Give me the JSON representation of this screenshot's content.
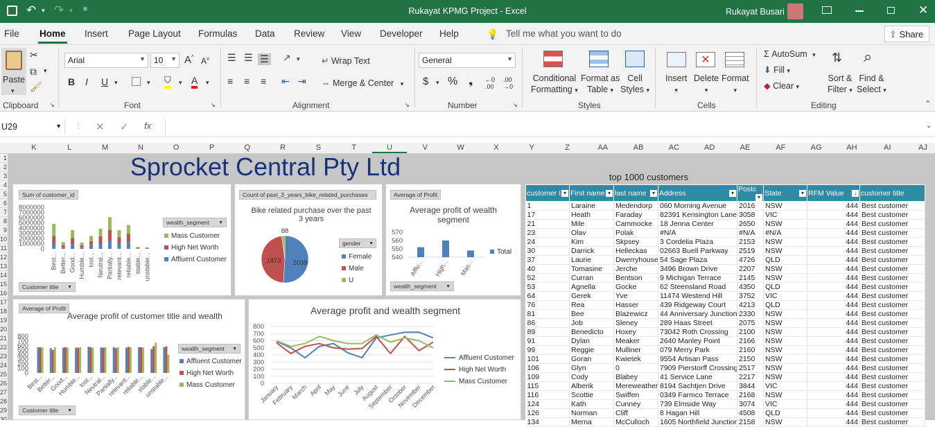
{
  "window": {
    "title": "Rukayat KPMG Project  -  Excel",
    "user": "Rukayat Busari"
  },
  "menu": {
    "tabs": [
      "File",
      "Home",
      "Insert",
      "Page Layout",
      "Formulas",
      "Data",
      "Review",
      "View",
      "Developer",
      "Help"
    ],
    "active": "Home",
    "tell_me": "Tell me what you want to do",
    "share": "Share"
  },
  "ribbon": {
    "paste": "Paste",
    "clipboard": "Clipboard",
    "font_name": "Arial",
    "font_size": "10",
    "font_group": "Font",
    "wrap_text": "Wrap Text",
    "merge_center": "Merge & Center",
    "alignment_group": "Alignment",
    "number_format": "General",
    "number_group": "Number",
    "conditional": "Conditional",
    "formatting": "Formatting",
    "format_as": "Format as",
    "table": "Table",
    "cell": "Cell",
    "styles_word": "Styles",
    "styles_group": "Styles",
    "insert": "Insert",
    "delete": "Delete",
    "format": "Format",
    "cells_group": "Cells",
    "autosum": "AutoSum",
    "fill": "Fill",
    "clear": "Clear",
    "sort_filter_1": "Sort &",
    "sort_filter_2": "Filter",
    "find_select_1": "Find &",
    "find_select_2": "Select",
    "editing_group": "Editing"
  },
  "formula_bar": {
    "name_box": "U29",
    "formula": ""
  },
  "columns": [
    "K",
    "L",
    "M",
    "N",
    "O",
    "P",
    "Q",
    "R",
    "S",
    "T",
    "U",
    "V",
    "W",
    "X",
    "Y",
    "Z",
    "AA",
    "AB",
    "AC",
    "AD",
    "AE",
    "AF",
    "AG",
    "AH",
    "AI",
    "AJ"
  ],
  "rows": [
    "1",
    "2",
    "3",
    "4",
    "5",
    "6",
    "7",
    "8",
    "9",
    "10",
    "11",
    "12",
    "13",
    "14",
    "15",
    "16",
    "17",
    "18",
    "19",
    "20",
    "21",
    "22",
    "23",
    "24",
    "25",
    "26",
    "27",
    "28",
    "29",
    "30"
  ],
  "dashboard": {
    "title": "Sprocket Central Pty Ltd",
    "table_title": "top 1000 customers"
  },
  "chart1": {
    "field_button": "Sum of customer_id",
    "filter_button": "Customer title",
    "legend_button": "wealth_segment",
    "chart_data": {
      "type": "bar",
      "stacked": true,
      "categories": [
        "Best...",
        "Better...",
        "Good...",
        "Humble...",
        "lost...",
        "Neutral...",
        "Partially...",
        "relevant...",
        "reliable...",
        "stable...",
        "unstable..."
      ],
      "series": [
        {
          "name": "Mass Customer",
          "color": "#9bbb59",
          "values": [
            2300000,
            600000,
            1500000,
            500000,
            1000000,
            1500000,
            2500000,
            1400000,
            1700000,
            150000,
            100000
          ]
        },
        {
          "name": "High Net Worth",
          "color": "#c0504d",
          "values": [
            1500000,
            400000,
            1200000,
            400000,
            800000,
            1400000,
            2000000,
            1200000,
            1600000,
            100000,
            100000
          ]
        },
        {
          "name": "Affluent Customer",
          "color": "#4f81bd",
          "values": [
            1000000,
            300000,
            900000,
            300000,
            700000,
            1000000,
            1600000,
            1000000,
            1300000,
            100000,
            80000
          ]
        }
      ],
      "yticks": [
        "8000000",
        "7000000",
        "6000000",
        "5000000",
        "4000000",
        "3000000",
        "2000000",
        "1000000",
        "0"
      ],
      "ylim": [
        0,
        8000000
      ]
    }
  },
  "chart2": {
    "field_button": "Count of past_3_years_bike_related_purchases",
    "legend_button": "gender",
    "chart_data": {
      "type": "pie",
      "title": "Bike related purchase over the past 3 years",
      "slices": [
        {
          "name": "Female",
          "value": 2039,
          "color": "#4f81bd"
        },
        {
          "name": "Male",
          "value": 1873,
          "color": "#c0504d"
        },
        {
          "name": "U",
          "value": 88,
          "color": "#9bbb59"
        }
      ]
    }
  },
  "chart3": {
    "field_button": "Average of Profit",
    "filter_button": "wealth_segment",
    "chart_data": {
      "type": "bar",
      "title": "Average profit of wealth segment",
      "categories": [
        "Afflu...",
        "High...",
        "Mas..."
      ],
      "series": [
        {
          "name": "Total",
          "color": "#4f81bd",
          "values": [
            552,
            560,
            548
          ]
        }
      ],
      "yticks": [
        "570",
        "560",
        "550",
        "540"
      ],
      "ylim": [
        540,
        570
      ]
    }
  },
  "chart4": {
    "field_button": "Average of Profit",
    "filter_button": "Customer title",
    "legend_button": "wealth_segment",
    "chart_data": {
      "type": "bar",
      "title": "Average profit  of customer title and wealth",
      "categories": [
        "Best...",
        "Better...",
        "Good...",
        "Humble...",
        "lost...",
        "Neutral...",
        "Partially...",
        "relevant...",
        "reliable...",
        "stable...",
        "unstable..."
      ],
      "series": [
        {
          "name": "Affluent Customer",
          "color": "#4f81bd",
          "values": [
            560,
            540,
            550,
            550,
            570,
            555,
            560,
            550,
            560,
            520,
            560
          ]
        },
        {
          "name": "High Net Worth",
          "color": "#c0504d",
          "values": [
            560,
            500,
            560,
            550,
            560,
            550,
            540,
            570,
            560,
            580,
            580
          ]
        },
        {
          "name": "Mass Customer",
          "color": "#9bbb59",
          "values": [
            550,
            560,
            550,
            560,
            550,
            560,
            560,
            560,
            550,
            660,
            400
          ]
        }
      ],
      "yticks": [
        "800",
        "700",
        "600",
        "500",
        "400",
        "300",
        "200",
        "100",
        "0"
      ],
      "ylim": [
        0,
        800
      ]
    }
  },
  "chart5": {
    "chart_data": {
      "type": "line",
      "title": "Average profit and wealth segment",
      "categories": [
        "January",
        "February",
        "March",
        "April",
        "May",
        "June",
        "July",
        "August",
        "September",
        "October",
        "November",
        "December"
      ],
      "series": [
        {
          "name": "Affluent Customer",
          "color": "#4f81bd",
          "values": [
            590,
            500,
            360,
            520,
            560,
            430,
            360,
            640,
            680,
            720,
            720,
            640
          ]
        },
        {
          "name": "High Net Worth",
          "color": "#c0504d",
          "values": [
            570,
            420,
            520,
            560,
            500,
            480,
            490,
            660,
            420,
            660,
            460,
            580
          ]
        },
        {
          "name": "Mass Customer",
          "color": "#9bbb59",
          "values": [
            600,
            520,
            560,
            660,
            600,
            560,
            560,
            680,
            580,
            640,
            600,
            500
          ]
        }
      ],
      "yticks": [
        "800",
        "700",
        "600",
        "500",
        "400",
        "300",
        "200",
        "100",
        "0"
      ],
      "ylim": [
        0,
        800
      ]
    }
  },
  "table": {
    "headers": [
      "customer I",
      "First name",
      "last name",
      "Address",
      "Postc",
      "State",
      "RFM Value",
      "customer title"
    ],
    "rows": [
      [
        "1",
        "Laraine",
        "Medendorp",
        "060 Morning Avenue",
        "2016",
        "NSW",
        "444",
        "Best customer"
      ],
      [
        "17",
        "Heath",
        "Faraday",
        "82391 Kensington Lane",
        "3058",
        "VIC",
        "444",
        "Best customer"
      ],
      [
        "21",
        "Mile",
        "Cammocke",
        "18 Jenna Center",
        "2650",
        "NSW",
        "444",
        "Best customer"
      ],
      [
        "23",
        "Olav",
        "Polak",
        "#N/A",
        "#N/A",
        "#N/A",
        "444",
        "Best customer"
      ],
      [
        "24",
        "Kim",
        "Skpsey",
        "3 Cordelia Plaza",
        "2153",
        "NSW",
        "444",
        "Best customer"
      ],
      [
        "30",
        "Darrick",
        "Helleckas",
        "02663 Buell Parkway",
        "2519",
        "NSW",
        "444",
        "Best customer"
      ],
      [
        "37",
        "Laurie",
        "Dwerryhouse",
        "54 Sage Plaza",
        "4726",
        "QLD",
        "444",
        "Best customer"
      ],
      [
        "40",
        "Tomasine",
        "Jerche",
        "3496 Brown Drive",
        "2207",
        "NSW",
        "444",
        "Best customer"
      ],
      [
        "52",
        "Curran",
        "Bentson",
        "9 Michigan Terrace",
        "2145",
        "NSW",
        "444",
        "Best customer"
      ],
      [
        "53",
        "Agnella",
        "Gocke",
        "62 Steensland Road",
        "4350",
        "QLD",
        "444",
        "Best customer"
      ],
      [
        "64",
        "Gerek",
        "Yve",
        "11474 Westend Hill",
        "3752",
        "VIC",
        "444",
        "Best customer"
      ],
      [
        "76",
        "Rea",
        "Hasser",
        "439 Ridgeway Court",
        "4213",
        "QLD",
        "444",
        "Best customer"
      ],
      [
        "81",
        "Bee",
        "Blazewicz",
        "44 Anniversary Junction",
        "2330",
        "NSW",
        "444",
        "Best customer"
      ],
      [
        "86",
        "Job",
        "Sleney",
        "289 Haas Street",
        "2075",
        "NSW",
        "444",
        "Best customer"
      ],
      [
        "89",
        "Benedicto",
        "Hoxey",
        "73042 Roth Crossing",
        "2100",
        "NSW",
        "444",
        "Best customer"
      ],
      [
        "91",
        "Dylan",
        "Meaker",
        "2640 Manley Point",
        "2166",
        "NSW",
        "444",
        "Best customer"
      ],
      [
        "99",
        "Reggie",
        "Mulliner",
        "079 Merry Park",
        "2160",
        "NSW",
        "444",
        "Best customer"
      ],
      [
        "101",
        "Goran",
        "Kwietek",
        "9554 Artisan Pass",
        "2150",
        "NSW",
        "444",
        "Best customer"
      ],
      [
        "106",
        "Glyn",
        "0",
        "7909 Pierstorff Crossing",
        "2517",
        "NSW",
        "444",
        "Best customer"
      ],
      [
        "109",
        "Cody",
        "Blabey",
        "41 Service Lane",
        "2217",
        "NSW",
        "444",
        "Best customer"
      ],
      [
        "115",
        "Alberik",
        "Mereweather",
        "8194 Sachtjen Drive",
        "3844",
        "VIC",
        "444",
        "Best customer"
      ],
      [
        "116",
        "Scottie",
        "Swiffen",
        "0349 Farmco Terrace",
        "2168",
        "NSW",
        "444",
        "Best customer"
      ],
      [
        "124",
        "Kath",
        "Cunney",
        "739 Elmside Way",
        "3074",
        "VIC",
        "444",
        "Best customer"
      ],
      [
        "126",
        "Norman",
        "Cliff",
        "8 Hagan Hill",
        "4508",
        "QLD",
        "444",
        "Best customer"
      ],
      [
        "134",
        "Merna",
        "McCulloch",
        "1605 Northfield Junction",
        "2158",
        "NSW",
        "444",
        "Best customer"
      ]
    ]
  }
}
